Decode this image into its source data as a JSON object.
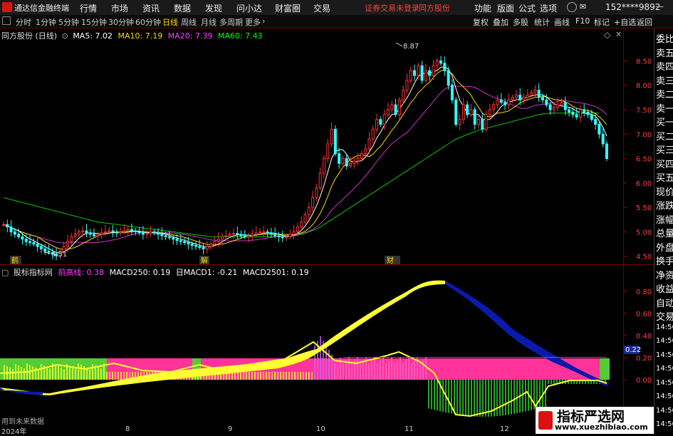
{
  "app": {
    "title": "通达信金融终端",
    "menu": [
      "行情",
      "市场",
      "资讯",
      "数据",
      "发现",
      "问小达",
      "财富圈",
      "交易"
    ],
    "warning": "证券交易未登录",
    "stock_link": "同方股份",
    "right_menu": [
      "功能",
      "版面",
      "公式",
      "选项"
    ],
    "phone": "152****9892"
  },
  "toolbar": {
    "periods": [
      "分时",
      "1分钟",
      "5分钟",
      "15分钟",
      "30分钟",
      "60分钟",
      "日线",
      "周线",
      "月线",
      "多周期",
      "更多"
    ],
    "active_period": "日线",
    "right_buttons": [
      "复权",
      "叠加",
      "多股",
      "统计",
      "画线",
      "F10",
      "标记",
      "+自选",
      "返回"
    ]
  },
  "main_chart": {
    "title": "同方股份 (日线)",
    "ma": [
      {
        "label": "MA5: 7.02",
        "color": "#ffffff"
      },
      {
        "label": "MA10: 7.19",
        "color": "#ffd700"
      },
      {
        "label": "MA20: 7.39",
        "color": "#ff40ff"
      },
      {
        "label": "MA60: 7.43",
        "color": "#00ff00"
      }
    ],
    "price_ticks": [
      "8.50",
      "8.00",
      "7.50",
      "7.00",
      "6.50",
      "6.00",
      "5.50",
      "5.00",
      "4.50"
    ],
    "high_label": "8.87",
    "low_label": "4.51",
    "markers": [
      "鹤",
      "解",
      "财"
    ]
  },
  "indicator": {
    "name": "股标指标网",
    "values": [
      {
        "label": "前高线: 0.38",
        "color": "#ff40ff"
      },
      {
        "label": "MACD250: 0.19",
        "color": "#ffffff"
      },
      {
        "label": "日MACD1: -0.21",
        "color": "#ffffff"
      },
      {
        "label": "MACD2501: 0.19",
        "color": "#ffffff"
      }
    ],
    "ticks": [
      "0.80",
      "0.60",
      "0.40",
      "0.20",
      "0.00"
    ],
    "current": "0.22",
    "future_note": "用到未来数据"
  },
  "right_panel": [
    "委比",
    "卖五",
    "卖四",
    "卖三",
    "卖二",
    "卖一",
    "买一",
    "买二",
    "买三",
    "买四",
    "买五",
    "现价",
    "涨跌",
    "涨幅",
    "总量",
    "外盘",
    "换手",
    "净资",
    "收益",
    "自动",
    "交易",
    "14:56",
    "14:56",
    "14:56",
    "14:56",
    "14:56",
    "14:56",
    "14:56",
    "14:56"
  ],
  "time_axis": [
    {
      "label": "2024年"
    },
    {
      "label": "8"
    },
    {
      "label": "9"
    },
    {
      "label": "10"
    },
    {
      "label": "11"
    },
    {
      "label": "12"
    }
  ],
  "watermark": {
    "title": "指标严选网",
    "url": "www.xuezhibiao.com"
  },
  "chart_data": {
    "type": "line",
    "title": "同方股份 (日线)",
    "close": [
      5.15,
      5.1,
      5.0,
      4.95,
      4.9,
      4.85,
      4.8,
      4.78,
      4.75,
      4.7,
      4.65,
      4.6,
      4.58,
      4.55,
      4.51,
      4.6,
      4.7,
      4.8,
      4.9,
      4.95,
      5.0,
      5.02,
      4.98,
      4.95,
      4.92,
      4.95,
      4.98,
      5.0,
      5.02,
      5.0,
      4.98,
      5.0,
      5.02,
      5.05,
      5.02,
      5.0,
      4.98,
      4.95,
      4.97,
      5.0,
      4.98,
      4.95,
      4.92,
      4.9,
      4.88,
      4.85,
      4.82,
      4.8,
      4.78,
      4.75,
      4.72,
      4.7,
      4.68,
      4.65,
      4.7,
      4.75,
      4.8,
      4.85,
      4.9,
      4.92,
      4.95,
      4.97,
      4.95,
      4.92,
      4.9,
      4.92,
      4.95,
      4.98,
      5.0,
      5.0,
      4.98,
      4.95,
      4.92,
      4.9,
      4.88,
      4.9,
      4.95,
      5.0,
      5.1,
      5.2,
      5.35,
      5.5,
      5.7,
      5.9,
      6.2,
      6.5,
      6.8,
      7.1,
      6.6,
      6.4,
      6.5,
      6.35,
      6.4,
      6.45,
      6.5,
      6.6,
      6.7,
      6.9,
      7.1,
      7.3,
      7.2,
      7.4,
      7.5,
      7.6,
      7.4,
      7.7,
      7.9,
      8.1,
      8.3,
      8.2,
      8.4,
      8.1,
      8.3,
      8.2,
      8.4,
      8.5,
      8.45,
      8.3,
      8.0,
      7.7,
      7.2,
      7.3,
      7.6,
      7.4,
      7.5,
      7.2,
      7.3,
      7.1,
      7.4,
      7.5,
      7.6,
      7.7,
      7.65,
      7.6,
      7.7,
      7.75,
      7.8,
      7.7,
      7.75,
      7.8,
      7.85,
      7.9,
      7.75,
      7.7,
      7.6,
      7.5,
      7.55,
      7.6,
      7.65,
      7.5,
      7.45,
      7.4,
      7.35,
      7.5,
      7.45,
      7.4,
      7.3,
      7.2,
      7.0,
      6.8,
      6.5
    ],
    "ma60": [
      5.7,
      5.68,
      5.66,
      5.64,
      5.62,
      5.6,
      5.58,
      5.56,
      5.54,
      5.52,
      5.5,
      5.48,
      5.46,
      5.44,
      5.42,
      5.4,
      5.38,
      5.36,
      5.34,
      5.32,
      5.3,
      5.28,
      5.26,
      5.24,
      5.22,
      5.2,
      5.19,
      5.18,
      5.17,
      5.16,
      5.15,
      5.14,
      5.13,
      5.12,
      5.11,
      5.1,
      5.09,
      5.08,
      5.07,
      5.06,
      5.05,
      5.04,
      5.03,
      5.02,
      5.01,
      5.0,
      4.99,
      4.98,
      4.97,
      4.96,
      4.95,
      4.94,
      4.93,
      4.92,
      4.91,
      4.9,
      4.9,
      4.9,
      4.9,
      4.9,
      4.9,
      4.9,
      4.9,
      4.9,
      4.9,
      4.9,
      4.9,
      4.9,
      4.9,
      4.9,
      4.9,
      4.9,
      4.9,
      4.9,
      4.9,
      4.9,
      4.91,
      4.92,
      4.93,
      4.95,
      4.97,
      5.0,
      5.03,
      5.06,
      5.1,
      5.15,
      5.2,
      5.25,
      5.3,
      5.35,
      5.4,
      5.45,
      5.5,
      5.55,
      5.6,
      5.65,
      5.7,
      5.75,
      5.8,
      5.85,
      5.9,
      5.95,
      6.0,
      6.05,
      6.1,
      6.15,
      6.2,
      6.25,
      6.3,
      6.35,
      6.4,
      6.45,
      6.5,
      6.55,
      6.6,
      6.65,
      6.7,
      6.75,
      6.8,
      6.85,
      6.9,
      6.93,
      6.96,
      6.99,
      7.02,
      7.05,
      7.08,
      7.1,
      7.12,
      7.14,
      7.16,
      7.18,
      7.2,
      7.22,
      7.24,
      7.26,
      7.28,
      7.3,
      7.32,
      7.34,
      7.36,
      7.38,
      7.4,
      7.41,
      7.42,
      7.43,
      7.43,
      7.43,
      7.43,
      7.43,
      7.43,
      7.43,
      7.43,
      7.43,
      7.43,
      7.43,
      7.43,
      7.43,
      7.43
    ]
  }
}
